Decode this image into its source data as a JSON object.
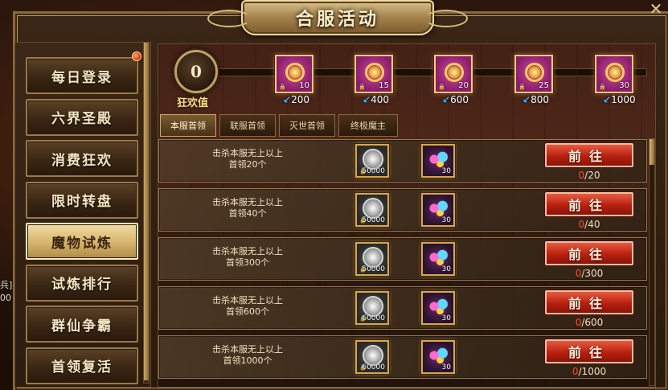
{
  "window": {
    "title": "合服活动",
    "close_icon": "close-icon"
  },
  "edge": {
    "line1": "兵]",
    "line2": "00"
  },
  "sidebar": {
    "items": [
      {
        "label": "每日登录",
        "active": false
      },
      {
        "label": "六界圣殿",
        "active": false
      },
      {
        "label": "消费狂欢",
        "active": false
      },
      {
        "label": "限时转盘",
        "active": false
      },
      {
        "label": "魔物试炼",
        "active": true
      },
      {
        "label": "试炼排行",
        "active": false
      },
      {
        "label": "群仙争霸",
        "active": false
      },
      {
        "label": "首领复活",
        "active": false
      }
    ]
  },
  "joy": {
    "value": "0",
    "label": "狂欢值",
    "progress": 0,
    "milestones": [
      {
        "qty": "10",
        "req": "200"
      },
      {
        "qty": "15",
        "req": "400"
      },
      {
        "qty": "20",
        "req": "600"
      },
      {
        "qty": "25",
        "req": "800"
      },
      {
        "qty": "30",
        "req": "1000"
      }
    ]
  },
  "tabs": [
    {
      "label": "本服首领",
      "active": true
    },
    {
      "label": "联服首领",
      "active": false
    },
    {
      "label": "灭世首领",
      "active": false
    },
    {
      "label": "终极魔主",
      "active": false
    }
  ],
  "tasks": [
    {
      "desc1": "击杀本服无上以上",
      "desc2": "首领20个",
      "coin": "50000",
      "firework": "30",
      "button": "前往",
      "current": "0",
      "target": "/20"
    },
    {
      "desc1": "击杀本服无上以上",
      "desc2": "首领40个",
      "coin": "50000",
      "firework": "30",
      "button": "前往",
      "current": "0",
      "target": "/40"
    },
    {
      "desc1": "击杀本服无上以上",
      "desc2": "首领300个",
      "coin": "50000",
      "firework": "30",
      "button": "前往",
      "current": "0",
      "target": "/300"
    },
    {
      "desc1": "击杀本服无上以上",
      "desc2": "首领600个",
      "coin": "60000",
      "firework": "30",
      "button": "前往",
      "current": "0",
      "target": "/600"
    },
    {
      "desc1": "击杀本服无上以上",
      "desc2": "首领1000个",
      "coin": "60000",
      "firework": "30",
      "button": "前往",
      "current": "0",
      "target": "/1000"
    }
  ],
  "colors": {
    "accent": "#d8a84a",
    "button_red": "#b82010",
    "progress_current": "#ff4a2a"
  }
}
